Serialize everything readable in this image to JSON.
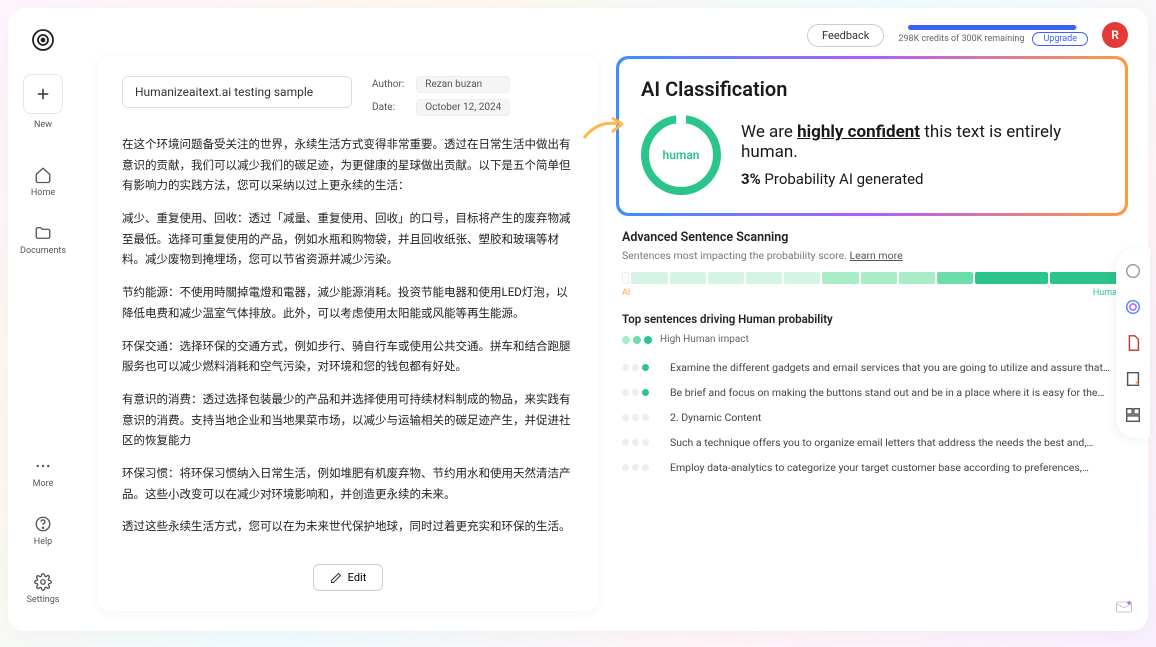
{
  "sidebar": {
    "new": "New",
    "home": "Home",
    "documents": "Documents",
    "more": "More",
    "help": "Help",
    "settings": "Settings"
  },
  "header": {
    "feedback": "Feedback",
    "credits": "298K credits of 300K remaining",
    "upgrade": "Upgrade",
    "avatar": "R"
  },
  "document": {
    "title": "Humanizeaitext.ai testing sample",
    "author_label": "Author:",
    "author": "Rezan buzan",
    "date_label": "Date:",
    "date": "October 12, 2024",
    "paragraphs": [
      "在这个环境问题备受关注的世界，永续生活方式变得非常重要。透过在日常生活中做出有意识的贡献，我们可以减少我们的碳足迹，为更健康的星球做出贡献。以下是五个简单但有影响力的实践方法，您可以采纳以过上更永续的生活：",
      "减少、重复使用、回收：透过「减量、重复使用、回收」的口号，目标将产生的废弃物减至最低。选择可重复使用的产品，例如水瓶和购物袋，并且回收纸张、塑胶和玻璃等材料。减少废物到掩埋场，您可以节省资源并减少污染。",
      "节约能源：不使用時關掉電燈和電器，減少能源消耗。投资节能电器和使用LED灯泡，以降低电费和减少温室气体排放。此外，可以考虑使用太阳能或风能等再生能源。",
      "环保交通：选择环保的交通方式，例如步行、骑自行车或使用公共交通。拼车和结合跑腿服务也可以减少燃料消耗和空气污染，对环境和您的钱包都有好处。",
      "有意识的消费：透过选择包装最少的产品和并选择使用可持续材料制成的物品，来实践有意识的消费。支持当地企业和当地果菜市场，以减少与运输相关的碳足迹产生，并促进社区的恢复能力",
      "环保习惯：将环保习惯纳入日常生活，例如堆肥有机废弃物、节约用水和使用天然清洁产品。这些小改变可以在减少对环境影响和，并创造更永续的未来。",
      "透过这些永续生活方式，您可以在为未来世代保护地球，同时过着更充实和环保的生活。"
    ],
    "edit": "Edit"
  },
  "classification": {
    "title": "AI Classification",
    "ring": "human",
    "line1_pre": "We are ",
    "line1_em": "highly confident",
    "line1_post": " this text is entirely human.",
    "percent": "3%",
    "percent_label": " Probability AI generated"
  },
  "scan": {
    "title": "Advanced Sentence Scanning",
    "subtitle": "Sentences most impacting the probability score. ",
    "learn": "Learn more",
    "label_ai": "AI",
    "label_human": "Human"
  },
  "top": {
    "title": "Top sentences driving Human probability",
    "impact": "High Human impact",
    "rows": [
      "Examine the different gadgets and email services that you are going to utilize and assure that…",
      "Be brief and focus on making the buttons stand out and be in a place where it is easy for the…",
      "2. Dynamic Content",
      "Such a technique offers you to organize email letters that address the needs the best and,…",
      "Employ data-analytics to categorize your target customer base according to preferences,…"
    ]
  }
}
